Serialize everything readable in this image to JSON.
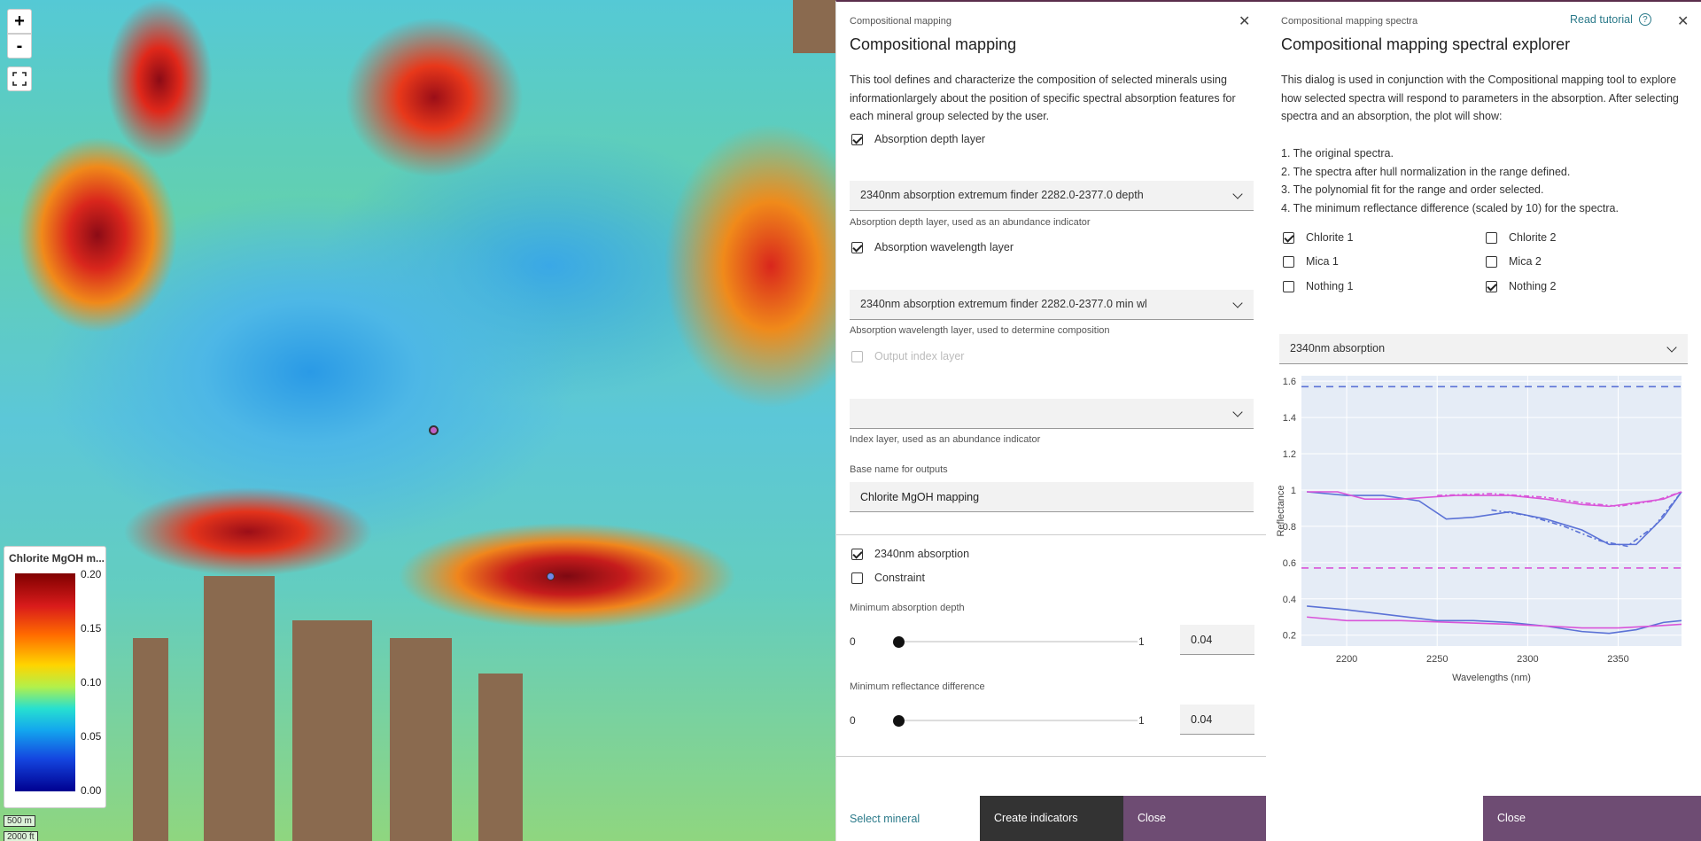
{
  "map": {
    "zoom_in": "+",
    "zoom_out": "-",
    "fullscreen_icon": "fullscreen-icon",
    "legend": {
      "title": "Chlorite MgOH m...",
      "ticks": [
        "0.20",
        "0.15",
        "0.10",
        "0.05",
        "0.00"
      ]
    },
    "scale": {
      "metric": "500 m",
      "imperial": "2000 ft"
    }
  },
  "panel1": {
    "header": "Compositional mapping",
    "title": "Compositional mapping",
    "description": "This tool defines and characterize the composition of selected minerals using informationlargely about the position of specific spectral absorption features for each mineral group selected by the user.",
    "absorption_depth_layer": {
      "label": "Absorption depth layer",
      "checked": true
    },
    "depth_select": {
      "value": "2340nm absorption extremum finder 2282.0-2377.0 depth",
      "helper": "Absorption depth layer, used as an abundance indicator"
    },
    "absorption_wavelength_layer": {
      "label": "Absorption wavelength layer",
      "checked": true
    },
    "wavelength_select": {
      "value": "2340nm absorption extremum finder 2282.0-2377.0 min wl",
      "helper": "Absorption wavelength layer, used to determine composition"
    },
    "output_index_layer": {
      "label": "Output index layer",
      "checked": false,
      "disabled": true
    },
    "index_select": {
      "value": "",
      "helper": "Index layer, used as an abundance indicator"
    },
    "base_name": {
      "label": "Base name for outputs",
      "value": "Chlorite MgOH mapping"
    },
    "absorption_2340": {
      "label": "2340nm absorption",
      "checked": true
    },
    "constraint": {
      "label": "Constraint",
      "checked": false
    },
    "min_absorption_depth": {
      "label": "Minimum absorption depth",
      "min": "0",
      "max": "1",
      "value": "0.04"
    },
    "min_reflectance_difference": {
      "label": "Minimum reflectance difference",
      "min": "0",
      "max": "1",
      "value": "0.04"
    },
    "footer": {
      "select_mineral": "Select mineral",
      "create_indicators": "Create indicators",
      "close": "Close"
    }
  },
  "panel2": {
    "header": "Compositional mapping spectra",
    "title": "Compositional mapping spectral explorer",
    "read_tutorial": "Read tutorial",
    "description": "This dialog is used in conjunction with the Compositional mapping tool to explore how selected spectra will respond to parameters in the absorption. After selecting spectra and an absorption, the plot will show:",
    "list": [
      "1. The original spectra.",
      "2. The spectra after hull normalization in the range defined.",
      "3. The polynomial fit for the range and order selected.",
      "4. The minimum reflectance difference (scaled by 10) for the spectra."
    ],
    "spectra": [
      {
        "label": "Chlorite 1",
        "checked": true
      },
      {
        "label": "Chlorite 2",
        "checked": false
      },
      {
        "label": "Mica 1",
        "checked": false
      },
      {
        "label": "Mica 2",
        "checked": false
      },
      {
        "label": "Nothing 1",
        "checked": false
      },
      {
        "label": "Nothing 2",
        "checked": true
      }
    ],
    "absorption_select": "2340nm absorption",
    "close": "Close"
  },
  "chart_data": {
    "type": "line",
    "xlabel": "Wavelengths (nm)",
    "ylabel": "Reflectance",
    "xlim": [
      2175,
      2385
    ],
    "ylim": [
      0.14,
      1.63
    ],
    "xticks": [
      "2200",
      "2250",
      "2300",
      "2350"
    ],
    "yticks": [
      "0.2",
      "0.4",
      "0.6",
      "0.8",
      "1",
      "1.2",
      "1.4",
      "1.6"
    ],
    "plot_bg": "#e5ecf6",
    "series": [
      {
        "color": "#5b72d6",
        "style": "solid",
        "x": [
          2178,
          2200,
          2220,
          2240,
          2255,
          2270,
          2290,
          2310,
          2330,
          2345,
          2360,
          2375,
          2385
        ],
        "y": [
          0.99,
          0.97,
          0.97,
          0.94,
          0.84,
          0.85,
          0.88,
          0.84,
          0.78,
          0.7,
          0.7,
          0.85,
          0.99
        ]
      },
      {
        "color": "#5b72d6",
        "style": "dashdot",
        "x": [
          2280,
          2300,
          2320,
          2340,
          2355,
          2370,
          2385
        ],
        "y": [
          0.89,
          0.86,
          0.8,
          0.72,
          0.69,
          0.8,
          0.99
        ]
      },
      {
        "color": "#d955d9",
        "style": "solid",
        "x": [
          2178,
          2195,
          2210,
          2230,
          2260,
          2290,
          2310,
          2330,
          2345,
          2360,
          2375,
          2385
        ],
        "y": [
          0.99,
          0.99,
          0.95,
          0.95,
          0.97,
          0.97,
          0.95,
          0.92,
          0.91,
          0.93,
          0.95,
          0.99
        ]
      },
      {
        "color": "#d955d9",
        "style": "dashdot",
        "x": [
          2250,
          2280,
          2310,
          2330,
          2350,
          2370,
          2385
        ],
        "y": [
          0.97,
          0.98,
          0.96,
          0.93,
          0.91,
          0.94,
          0.99
        ]
      },
      {
        "color": "#5b72d6",
        "style": "solid",
        "x": [
          2178,
          2200,
          2225,
          2250,
          2270,
          2290,
          2310,
          2330,
          2345,
          2360,
          2375,
          2385
        ],
        "y": [
          0.36,
          0.34,
          0.31,
          0.28,
          0.28,
          0.27,
          0.25,
          0.22,
          0.21,
          0.23,
          0.27,
          0.28
        ]
      },
      {
        "color": "#d955d9",
        "style": "solid",
        "x": [
          2178,
          2200,
          2230,
          2260,
          2290,
          2310,
          2330,
          2350,
          2370,
          2385
        ],
        "y": [
          0.3,
          0.28,
          0.28,
          0.27,
          0.26,
          0.25,
          0.24,
          0.24,
          0.25,
          0.26
        ]
      },
      {
        "color": "#5b72d6",
        "style": "dashed",
        "x": [
          2175,
          2385
        ],
        "y": [
          1.57,
          1.57
        ]
      },
      {
        "color": "#d955d9",
        "style": "dashed",
        "x": [
          2175,
          2385
        ],
        "y": [
          0.57,
          0.57
        ]
      }
    ]
  }
}
